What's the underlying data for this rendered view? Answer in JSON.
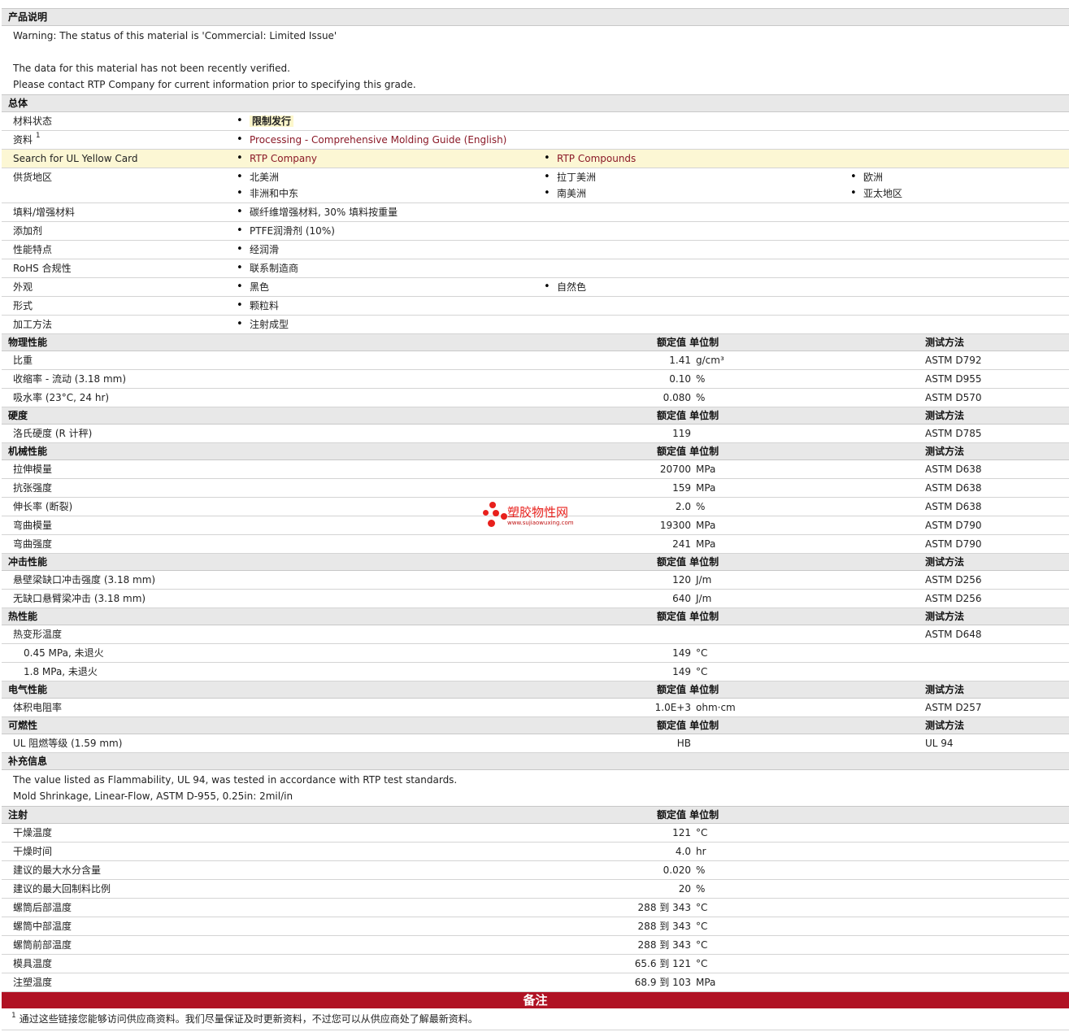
{
  "intro": {
    "title": "产品说明",
    "lines": [
      "Warning: The status of this material is 'Commercial: Limited Issue'",
      "",
      "The data for this material has not been recently verified.",
      "Please contact RTP Company for current information prior to specifying this grade."
    ]
  },
  "general": {
    "title": "总体",
    "status_label": "材料状态",
    "status_value": "限制发行",
    "docs_label": "资料",
    "docs_sup": "1",
    "docs_link": "Processing - Comprehensive Molding Guide (English)",
    "ul_label": "Search for UL Yellow Card",
    "ul_links": [
      "RTP Company",
      "RTP Compounds"
    ],
    "region_label": "供货地区",
    "regions": [
      "北美洲",
      "拉丁美洲",
      "欧洲",
      "非洲和中东",
      "南美洲",
      "亚太地区"
    ],
    "filler_label": "填料/增强材料",
    "filler_value": "碳纤维增强材料, 30% 填料按重量",
    "additive_label": "添加剂",
    "additive_value": "PTFE润滑剂  (10%)",
    "feature_label": "性能特点",
    "feature_value": "经润滑",
    "rohs_label": "RoHS 合规性",
    "rohs_value": "联系制造商",
    "appearance_label": "外观",
    "appearance_values": [
      "黑色",
      "自然色"
    ],
    "form_label": "形式",
    "form_value": "颗粒料",
    "process_label": "加工方法",
    "process_value": "注射成型"
  },
  "col_headers": {
    "value": "额定值 单位制",
    "method": "测试方法"
  },
  "physical": {
    "title": "物理性能",
    "rows": [
      {
        "label": "比重",
        "value": "1.41",
        "unit": "g/cm³",
        "method": "ASTM D792"
      },
      {
        "label": "收缩率  - 流动  (3.18 mm)",
        "value": "0.10",
        "unit": "%",
        "method": "ASTM D955"
      },
      {
        "label": "吸水率  (23°C, 24 hr)",
        "value": "0.080",
        "unit": "%",
        "method": "ASTM D570"
      }
    ]
  },
  "hardness": {
    "title": "硬度",
    "rows": [
      {
        "label": "洛氏硬度  (R 计秤)",
        "value": "119",
        "unit": "",
        "method": "ASTM D785"
      }
    ]
  },
  "mechanical": {
    "title": "机械性能",
    "rows": [
      {
        "label": "拉伸模量",
        "value": "20700",
        "unit": "MPa",
        "method": "ASTM D638"
      },
      {
        "label": "抗张强度",
        "value": "159",
        "unit": "MPa",
        "method": "ASTM D638"
      },
      {
        "label": "伸长率  (断裂)",
        "value": "2.0",
        "unit": "%",
        "method": "ASTM D638"
      },
      {
        "label": "弯曲模量",
        "value": "19300",
        "unit": "MPa",
        "method": "ASTM D790"
      },
      {
        "label": "弯曲强度",
        "value": "241",
        "unit": "MPa",
        "method": "ASTM D790"
      }
    ]
  },
  "impact": {
    "title": "冲击性能",
    "rows": [
      {
        "label": "悬壁梁缺口冲击强度  (3.18 mm)",
        "value": "120",
        "unit": "J/m",
        "method": "ASTM D256"
      },
      {
        "label": "无缺口悬臂梁冲击  (3.18 mm)",
        "value": "640",
        "unit": "J/m",
        "method": "ASTM D256"
      }
    ]
  },
  "thermal": {
    "title": "热性能",
    "rows": [
      {
        "label": "热变形温度",
        "value": "",
        "unit": "",
        "method": "ASTM D648"
      },
      {
        "label": "0.45 MPa, 未退火",
        "value": "149",
        "unit": "°C",
        "method": ""
      },
      {
        "label": "1.8 MPa, 未退火",
        "value": "149",
        "unit": "°C",
        "method": ""
      }
    ]
  },
  "electrical": {
    "title": "电气性能",
    "rows": [
      {
        "label": "体积电阻率",
        "value": "1.0E+3",
        "unit": "ohm·cm",
        "method": "ASTM D257"
      }
    ]
  },
  "flammability": {
    "title": "可燃性",
    "rows": [
      {
        "label": "UL 阻燃等级  (1.59 mm)",
        "value": "HB",
        "unit": "",
        "method": "UL 94"
      }
    ]
  },
  "supplement": {
    "title": "补充信息",
    "lines": [
      "The value listed as Flammability, UL 94, was tested in accordance with RTP test standards.",
      "Mold Shrinkage, Linear-Flow, ASTM D-955, 0.25in: 2mil/in"
    ]
  },
  "injection": {
    "title": "注射",
    "rows": [
      {
        "label": "干燥温度",
        "value": "121",
        "unit": "°C"
      },
      {
        "label": "干燥时间",
        "value": "4.0",
        "unit": "hr"
      },
      {
        "label": "建议的最大水分含量",
        "value": "0.020",
        "unit": "%"
      },
      {
        "label": "建议的最大回制料比例",
        "value": "20",
        "unit": "%"
      },
      {
        "label": "螺筒后部温度",
        "value": "288 到  343",
        "unit": "°C"
      },
      {
        "label": "螺筒中部温度",
        "value": "288 到  343",
        "unit": "°C"
      },
      {
        "label": "螺筒前部温度",
        "value": "288 到  343",
        "unit": "°C"
      },
      {
        "label": "模具温度",
        "value": "65.6 到  121",
        "unit": "°C"
      },
      {
        "label": "注塑温度",
        "value": "68.9 到  103",
        "unit": "MPa"
      }
    ]
  },
  "notes": {
    "title": "备注",
    "sup": "1",
    "text": "通过这些链接您能够访问供应商资料。我们尽量保证及时更新资料，不过您可以从供应商处了解最新资料。"
  },
  "watermark": {
    "name": "塑胶物性网",
    "url": "www.sujiaowuxing.com"
  }
}
